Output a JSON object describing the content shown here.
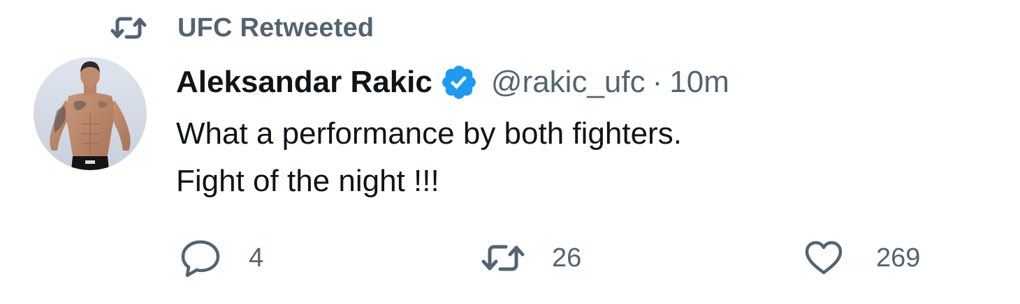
{
  "retweet_context": {
    "icon": "retweet-icon",
    "label": "UFC Retweeted"
  },
  "author": {
    "avatar": "fighter-photo-avatar",
    "display_name": "Aleksandar Rakic",
    "verified_icon": "verified-badge-icon",
    "handle": "@rakic_ufc",
    "separator": "·",
    "time": "10m"
  },
  "tweet": {
    "lines": [
      "What a performance by both fighters.",
      "Fight of the night !!!"
    ]
  },
  "actions": {
    "reply": {
      "icon": "reply-icon",
      "count": "4"
    },
    "retweet": {
      "icon": "retweet-icon",
      "count": "26"
    },
    "like": {
      "icon": "heart-icon",
      "count": "269"
    }
  },
  "colors": {
    "primary_text": "#0f1419",
    "secondary_text": "#536471",
    "verified_blue": "#1d9bf0"
  }
}
